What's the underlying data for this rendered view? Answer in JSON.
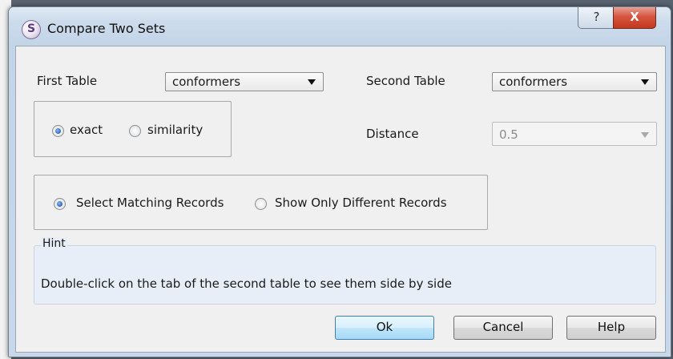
{
  "window": {
    "title": "Compare Two Sets",
    "help_glyph": "?",
    "close_glyph": "X",
    "app_glyph": "S"
  },
  "tables": {
    "first_label": "First Table",
    "first_value": "conformers",
    "second_label": "Second Table",
    "second_value": "conformers"
  },
  "match_mode": {
    "exact_label": "exact",
    "similarity_label": "similarity",
    "selected": "exact"
  },
  "distance": {
    "label": "Distance",
    "value": "0.5",
    "enabled": false
  },
  "record_mode": {
    "select_matching_label": "Select Matching Records",
    "show_different_label": "Show Only Different Records",
    "selected": "select_matching"
  },
  "hint": {
    "title": "Hint",
    "text": "Double-click on the tab of the second table to see them side by side"
  },
  "buttons": {
    "ok": "Ok",
    "cancel": "Cancel",
    "help": "Help"
  }
}
